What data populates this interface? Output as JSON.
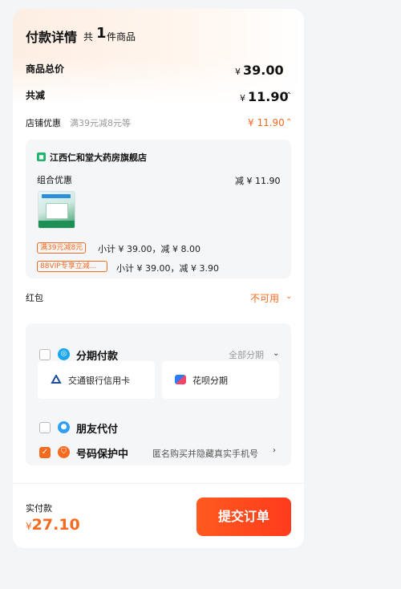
{
  "header": {
    "title": "付款详情",
    "count_prefix": "共",
    "count": "1",
    "count_suffix": "件商品"
  },
  "summary": {
    "goods_total_label": "商品总价",
    "goods_total_value": "39.00",
    "total_discount_label": "共减",
    "total_discount_value": "11.90",
    "currency": "¥"
  },
  "shop_discount": {
    "label": "店铺优惠",
    "hint": "满39元减8元等",
    "value": "¥ 11.90"
  },
  "shop": {
    "name": "江西仁和堂大药房旗舰店",
    "combo_label": "组合优惠",
    "combo_value": "减 ¥ 11.90",
    "promos": [
      {
        "tag": "满39元减8元",
        "text": "小计 ¥ 39.00，减 ¥ 8.00"
      },
      {
        "tag": "88VIP专享立减...",
        "text": "小计 ¥ 39.00，减 ¥ 3.90"
      }
    ]
  },
  "red_packet": {
    "label": "红包",
    "status": "不可用"
  },
  "payment": {
    "installment_label": "分期付款",
    "installment_option": "全部分期",
    "card_bank": "交通银行信用卡",
    "card_huabei": "花呗分期",
    "friend_pay_label": "朋友代付",
    "number_protect_label": "号码保护中",
    "number_protect_desc": "匿名购买并隐藏真实手机号"
  },
  "footer": {
    "actual_label": "实付款",
    "actual_value": "27.10",
    "currency": "¥",
    "submit_label": "提交订单"
  },
  "colors": {
    "accent": "#f56a1f",
    "button": "#ff4a1e",
    "panel": "#f5f6f8"
  },
  "icons": [
    "shop-icon",
    "installment-icon",
    "bank-icon",
    "huabei-icon",
    "friend-pay-icon",
    "shield-icon",
    "chevron-up-icon",
    "chevron-down-icon",
    "chevron-right-icon",
    "checkmark-icon"
  ]
}
